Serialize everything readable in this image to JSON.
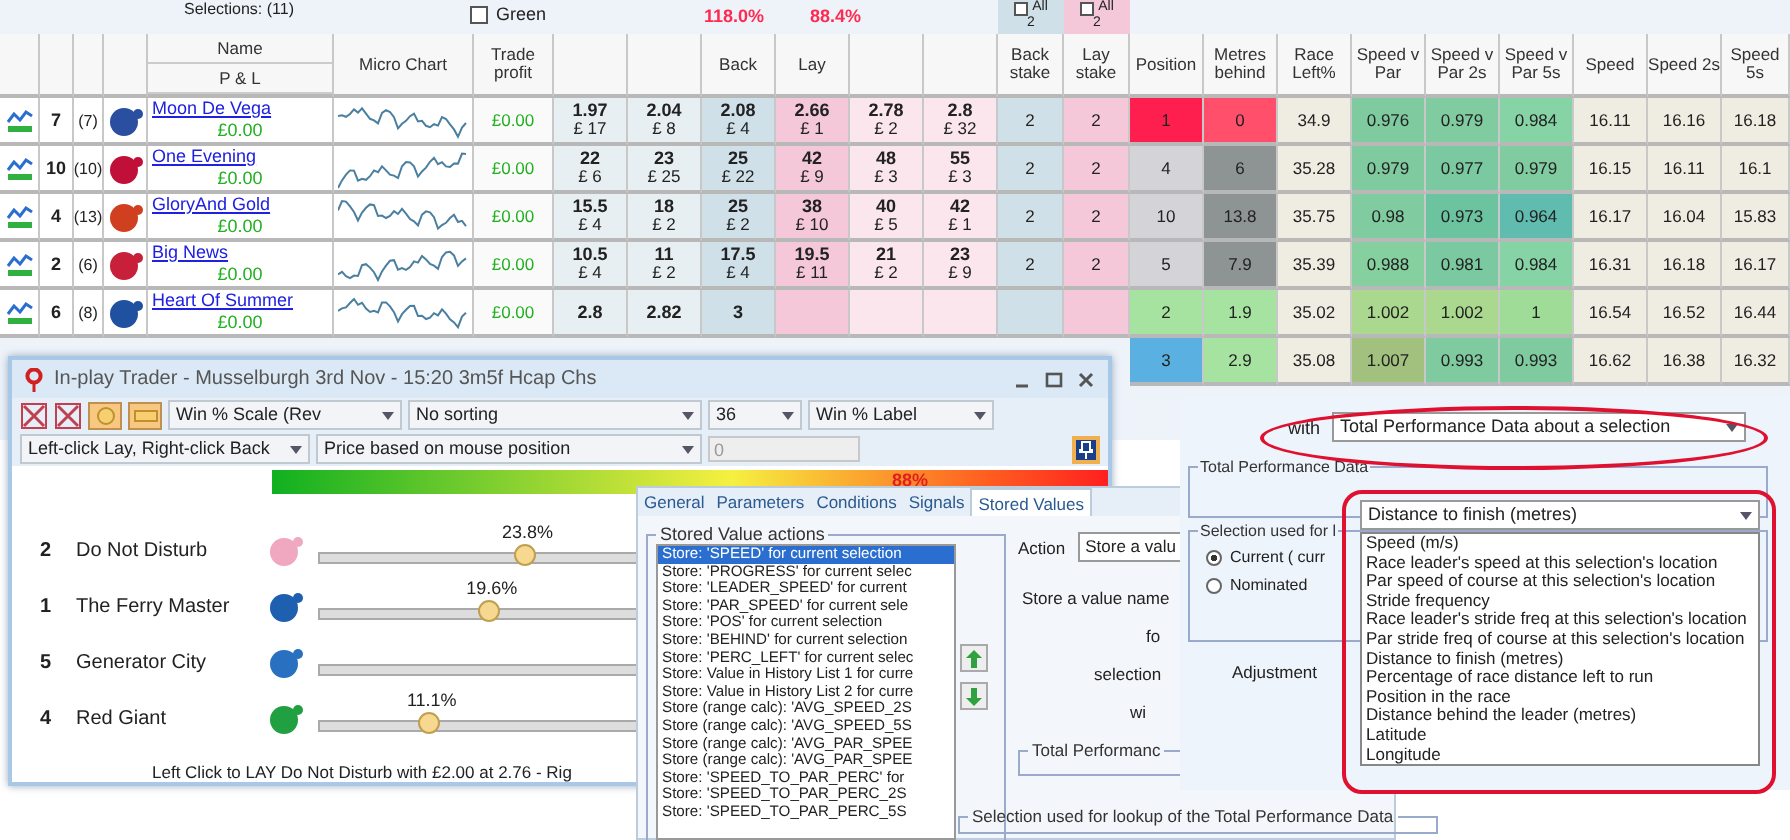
{
  "grid": {
    "selections": "Selections: (11)",
    "green_filter": {
      "label": "Green",
      "checked": false
    },
    "back_book": "118.0%",
    "lay_book": "88.4%",
    "all_back": {
      "label": "All",
      "checked": false,
      "count": "2"
    },
    "all_lay": {
      "label": "All",
      "checked": false,
      "count": "2"
    },
    "header": {
      "name": "Name",
      "pnl": "P & L",
      "chart": "Micro Chart",
      "trade": "Trade profit",
      "back": "Back",
      "lay": "Lay",
      "back_stake": "Back stake",
      "lay_stake": "Lay stake",
      "stats": [
        "Position",
        "Metres behind",
        "Race Left%",
        "Speed v Par",
        "Speed v Par 2s",
        "Speed v Par 5s",
        "Speed",
        "Speed 2s",
        "Speed 5s"
      ]
    },
    "rows": [
      {
        "number": "7",
        "draw": "(7)",
        "color": "#2a4fa0",
        "name": "Moon De Vega",
        "pnl": "£0.00",
        "trade_profit": "£0.00",
        "prices": [
          {
            "price": "1.97",
            "amount": "£ 17"
          },
          {
            "price": "2.04",
            "amount": "£ 8"
          },
          {
            "price": "2.08",
            "amount": "£ 4"
          },
          {
            "price": "2.66",
            "amount": "£ 1"
          },
          {
            "price": "2.78",
            "amount": "£ 2"
          },
          {
            "price": "2.8",
            "amount": "£ 32"
          }
        ],
        "back_stake": "2",
        "lay_stake": "2",
        "stats": [
          {
            "text": "1",
            "color": "#ff1f4f"
          },
          {
            "text": "0",
            "color": "#ff4f6a"
          },
          {
            "text": "34.9",
            "color": "#efece2"
          },
          {
            "text": "0.976",
            "color": "#7fcb9f"
          },
          {
            "text": "0.979",
            "color": "#80cca0"
          },
          {
            "text": "0.984",
            "color": "#86d3a6"
          },
          {
            "text": "16.11",
            "color": "#efece2"
          },
          {
            "text": "16.16",
            "color": "#efece2"
          },
          {
            "text": "16.18",
            "color": "#efece2"
          }
        ]
      },
      {
        "number": "10",
        "draw": "(10)",
        "color": "#c0103a",
        "name": "One Evening",
        "pnl": "£0.00",
        "trade_profit": "£0.00",
        "prices": [
          {
            "price": "22",
            "amount": "£ 6"
          },
          {
            "price": "23",
            "amount": "£ 25"
          },
          {
            "price": "25",
            "amount": "£ 22"
          },
          {
            "price": "42",
            "amount": "£ 9"
          },
          {
            "price": "48",
            "amount": "£ 3"
          },
          {
            "price": "55",
            "amount": "£ 3"
          }
        ],
        "back_stake": "2",
        "lay_stake": "2",
        "stats": [
          {
            "text": "4",
            "color": "#d4d4d8"
          },
          {
            "text": "6",
            "color": "#8e9494"
          },
          {
            "text": "35.28",
            "color": "#efece2"
          },
          {
            "text": "0.979",
            "color": "#7fcb9f"
          },
          {
            "text": "0.977",
            "color": "#7bc9a0"
          },
          {
            "text": "0.979",
            "color": "#80cca0"
          },
          {
            "text": "16.15",
            "color": "#efece2"
          },
          {
            "text": "16.11",
            "color": "#efece2"
          },
          {
            "text": "16.1",
            "color": "#efece2"
          }
        ]
      },
      {
        "number": "4",
        "draw": "(13)",
        "color": "#d04020",
        "name": "GloryAnd Gold",
        "pnl": "£0.00",
        "trade_profit": "£0.00",
        "prices": [
          {
            "price": "15.5",
            "amount": "£ 4"
          },
          {
            "price": "18",
            "amount": "£ 2"
          },
          {
            "price": "25",
            "amount": "£ 2"
          },
          {
            "price": "38",
            "amount": "£ 10"
          },
          {
            "price": "40",
            "amount": "£ 5"
          },
          {
            "price": "42",
            "amount": "£ 1"
          }
        ],
        "back_stake": "2",
        "lay_stake": "2",
        "stats": [
          {
            "text": "10",
            "color": "#d4d4d8"
          },
          {
            "text": "13.8",
            "color": "#8e9494"
          },
          {
            "text": "35.75",
            "color": "#efece2"
          },
          {
            "text": "0.98",
            "color": "#80cca0"
          },
          {
            "text": "0.973",
            "color": "#6cc3a0"
          },
          {
            "text": "0.964",
            "color": "#5fbcae"
          },
          {
            "text": "16.17",
            "color": "#efece2"
          },
          {
            "text": "16.04",
            "color": "#efece2"
          },
          {
            "text": "15.83",
            "color": "#efece2"
          }
        ]
      },
      {
        "number": "2",
        "draw": "(6)",
        "color": "#c8203a",
        "name": "Big News",
        "pnl": "£0.00",
        "trade_profit": "£0.00",
        "prices": [
          {
            "price": "10.5",
            "amount": "£ 4"
          },
          {
            "price": "11",
            "amount": "£ 2"
          },
          {
            "price": "17.5",
            "amount": "£ 4"
          },
          {
            "price": "19.5",
            "amount": "£ 11"
          },
          {
            "price": "21",
            "amount": "£ 2"
          },
          {
            "price": "23",
            "amount": "£ 9"
          }
        ],
        "back_stake": "2",
        "lay_stake": "2",
        "stats": [
          {
            "text": "5",
            "color": "#d4d4d8"
          },
          {
            "text": "7.9",
            "color": "#8e9494"
          },
          {
            "text": "35.39",
            "color": "#efece2"
          },
          {
            "text": "0.988",
            "color": "#86d09f"
          },
          {
            "text": "0.981",
            "color": "#7bc9a0"
          },
          {
            "text": "0.984",
            "color": "#86d3a6"
          },
          {
            "text": "16.31",
            "color": "#efece2"
          },
          {
            "text": "16.18",
            "color": "#efece2"
          },
          {
            "text": "16.17",
            "color": "#efece2"
          }
        ]
      },
      {
        "number": "6",
        "draw": "(8)",
        "color": "#2050a0",
        "name": "Heart Of Summer",
        "pnl": "£0.00",
        "trade_profit": "£0.00",
        "prices": [
          {
            "price": "2.8"
          },
          {
            "price": "2.82"
          },
          {
            "price": "3"
          }
        ],
        "stats": [
          {
            "text": "2",
            "color": "#a6e3a0"
          },
          {
            "text": "1.9",
            "color": "#a6e3a0"
          },
          {
            "text": "35.02",
            "color": "#efece2"
          },
          {
            "text": "1.002",
            "color": "#a9d88e"
          },
          {
            "text": "1.002",
            "color": "#a9d88e"
          },
          {
            "text": "1",
            "color": "#9fdc98"
          },
          {
            "text": "16.54",
            "color": "#efece2"
          },
          {
            "text": "16.52",
            "color": "#efece2"
          },
          {
            "text": "16.44",
            "color": "#efece2"
          }
        ]
      },
      {
        "stats": [
          {
            "text": "3",
            "color": "#5ab0e0"
          },
          {
            "text": "2.9",
            "color": "#a6e3a0"
          },
          {
            "text": "35.08",
            "color": "#efece2"
          },
          {
            "text": "1.007",
            "color": "#a2c07e"
          },
          {
            "text": "0.993",
            "color": "#7fcb9f"
          },
          {
            "text": "0.993",
            "color": "#7fcb9f"
          },
          {
            "text": "16.62",
            "color": "#efece2"
          },
          {
            "text": "16.38",
            "color": "#efece2"
          },
          {
            "text": "16.32",
            "color": "#efece2"
          }
        ]
      }
    ]
  },
  "trader": {
    "title": "In-play Trader - Musselburgh 3rd Nov - 15:20 3m5f Hcap Chs",
    "scale": "Win % Scale (Rev",
    "sorting": "No sorting",
    "count": "36",
    "label_mode": "Win % Label",
    "click_mode": "Left-click Lay, Right-click Back",
    "price_mode": "Price based on mouse position",
    "amount": "0",
    "gradient_label": "88%",
    "runners": [
      {
        "number": "2",
        "name": "Do Not Disturb",
        "color": "#f0a8c0",
        "percent": "23.8%",
        "level": 0.52
      },
      {
        "number": "1",
        "name": "The Ferry Master",
        "color": "#1f5fb0",
        "percent": "19.6%",
        "level": 0.43
      },
      {
        "number": "5",
        "name": "Generator City",
        "color": "#2a70c0"
      },
      {
        "number": "4",
        "name": "Red Giant",
        "color": "#20a040",
        "percent": "11.1%",
        "level": 0.28
      }
    ],
    "status": "Left Click to LAY Do Not Disturb with £2.00 at 2.76 - Rig"
  },
  "rule_editor": {
    "tabs": [
      {
        "label": "General",
        "selected": false
      },
      {
        "label": "Parameters",
        "selected": false
      },
      {
        "label": "Conditions",
        "selected": false
      },
      {
        "label": "Signals",
        "selected": false
      },
      {
        "label": "Stored Values",
        "selected": true
      }
    ],
    "actions_group": "Stored Value actions",
    "actions": [
      {
        "label": "Store: 'SPEED' for current selection",
        "selected": true
      },
      {
        "label": "Store: 'PROGRESS' for current selec",
        "selected": false
      },
      {
        "label": "Store: 'LEADER_SPEED' for current",
        "selected": false
      },
      {
        "label": "Store: 'PAR_SPEED' for current sele",
        "selected": false
      },
      {
        "label": "Store: 'POS' for current selection",
        "selected": false
      },
      {
        "label": "Store: 'BEHIND' for current selection",
        "selected": false
      },
      {
        "label": "Store: 'PERC_LEFT' for current selec",
        "selected": false
      },
      {
        "label": "Store: Value in History List 1 for curre",
        "selected": false
      },
      {
        "label": "Store: Value in History List 2 for curre",
        "selected": false
      },
      {
        "label": "Store (range calc): 'AVG_SPEED_2S",
        "selected": false
      },
      {
        "label": "Store (range calc): 'AVG_SPEED_5S",
        "selected": false
      },
      {
        "label": "Store (range calc): 'AVG_PAR_SPEE",
        "selected": false
      },
      {
        "label": "Store (range calc): 'AVG_PAR_SPEE",
        "selected": false
      },
      {
        "label": "Store: 'SPEED_TO_PAR_PERC' for",
        "selected": false
      },
      {
        "label": "Store: 'SPEED_TO_PAR_PERC_2S",
        "selected": false
      },
      {
        "label": "Store: 'SPEED_TO_PAR_PERC_5S",
        "selected": false
      }
    ],
    "action_label": "Action",
    "action_value": "Store a valu",
    "named_label": "Store a value name",
    "for_label": "fo",
    "selection_label": "selection",
    "with_label": "wi",
    "perf_group": "Total Performanc",
    "lookup_group": "Selection used for lookup of the Total Performance Data"
  },
  "data_dialog": {
    "with_label": "with",
    "source": "Total Performance Data about a selection",
    "data_group": "Total Performance Data",
    "field": "Distance to finish (metres)",
    "options": [
      "Speed (m/s)",
      "Race leader's speed at this selection's location",
      "Par speed of course at this selection's location",
      "Stride frequency",
      "Race leader's stride freq at this selection's location",
      "Par stride freq of course at this selection's location",
      "Distance to finish (metres)",
      "Percentage of race distance left to run",
      "Position in the race",
      "Distance behind the leader (metres)",
      "Latitude",
      "Longitude"
    ],
    "selection_group": "Selection used for l",
    "radios": [
      {
        "label": "Current ( curr",
        "selected": true
      },
      {
        "label": "Nominated",
        "selected": false
      }
    ],
    "adjustment_label": "Adjustment"
  }
}
